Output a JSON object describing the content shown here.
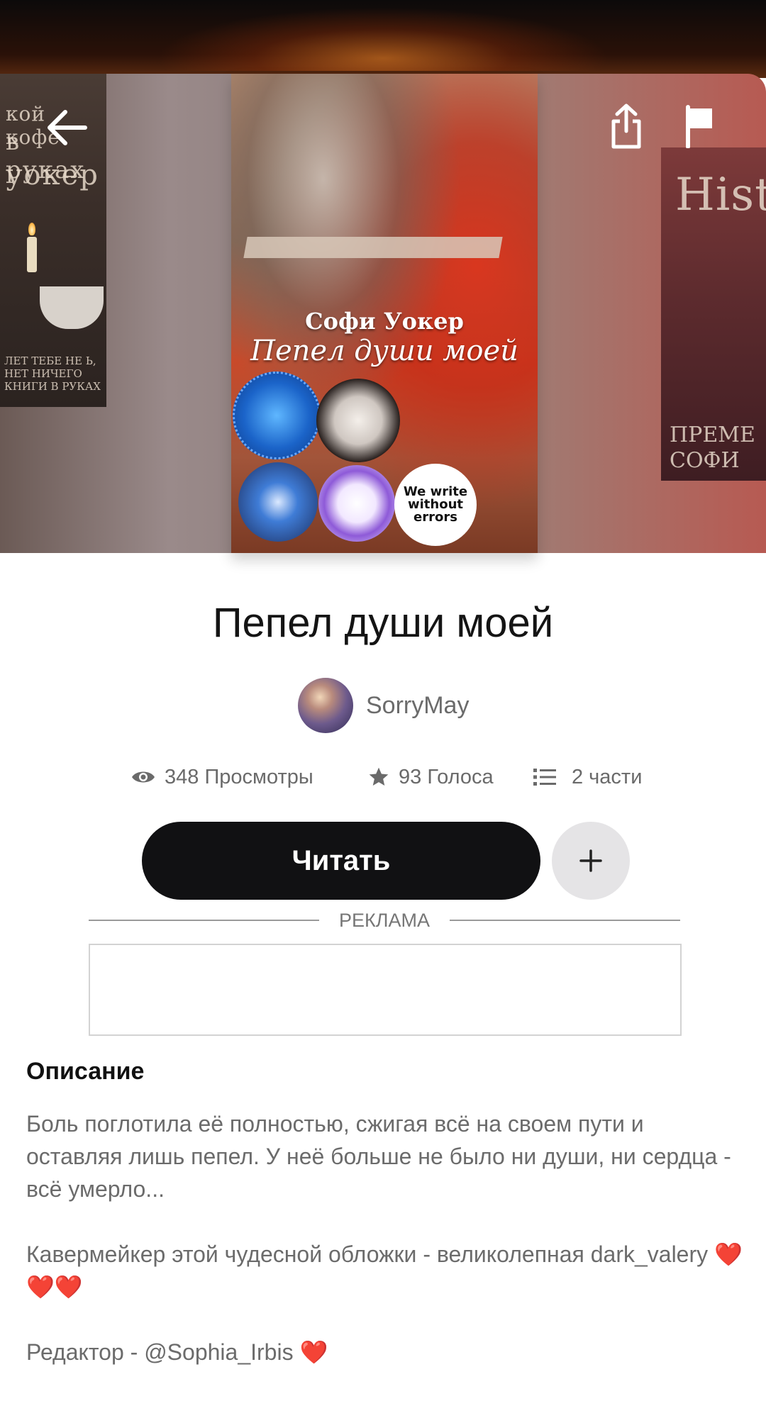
{
  "cover": {
    "author": "Софи Уокер",
    "title": "Пепел души моей",
    "badge_text": "We write without errors"
  },
  "left_cover": {
    "line1": "кой кофе",
    "line2": "в руках",
    "line3": "уокер",
    "bottom": "ЛЕТ ТЕБЕ НЕ Ь, НЕТ НИЧЕГО КНИГИ В РУКАХ"
  },
  "right_cover": {
    "line1": "Hist",
    "bottom": "ПРЕМЕ СОФИ"
  },
  "story": {
    "title": "Пепел души моей",
    "author": "SorryMay"
  },
  "stats": {
    "views": "348 Просмотры",
    "votes": "93 Голоса",
    "parts": "2 части"
  },
  "actions": {
    "read_label": "Читать",
    "add_label": "+"
  },
  "ad": {
    "label": "РЕКЛАМА"
  },
  "description": {
    "heading": "Описание",
    "p1": "Боль поглотила её полностью, сжигая всё на своем пути и оставляя лишь пепел. У неё больше не было ни души, ни сердца - всё умерло...",
    "p2": "Кавермейкер этой чудесной обложки - великолепная dark_valery",
    "p2_emoji": "❤️❤️❤️",
    "p3": "Редактор - @Sophia_Irbis",
    "p3_emoji": "❤️"
  },
  "icons": {
    "back": "arrow-left-icon",
    "share": "share-icon",
    "report": "flag-icon",
    "views": "eye-icon",
    "votes": "star-icon",
    "parts": "list-icon",
    "add": "plus-icon"
  },
  "colors": {
    "read_button_bg": "#111113",
    "add_button_bg": "#e5e4e6",
    "stat_text": "#6a6a6a"
  }
}
